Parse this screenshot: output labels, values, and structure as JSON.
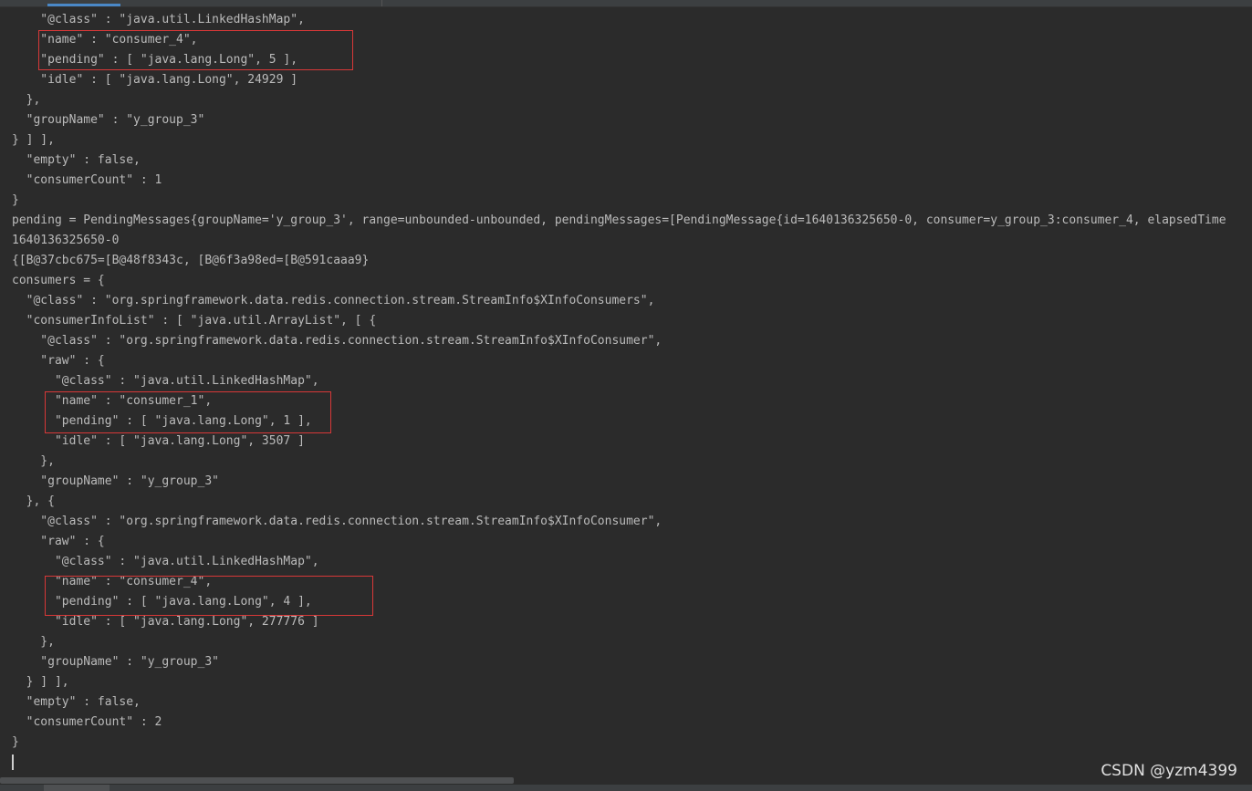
{
  "console": {
    "lines": [
      "    \"@class\" : \"java.util.LinkedHashMap\",",
      "    \"name\" : \"consumer_4\",",
      "    \"pending\" : [ \"java.lang.Long\", 5 ],",
      "    \"idle\" : [ \"java.lang.Long\", 24929 ]",
      "  },",
      "  \"groupName\" : \"y_group_3\"",
      "} ] ],",
      "  \"empty\" : false,",
      "  \"consumerCount\" : 1",
      "}",
      "pending = PendingMessages{groupName='y_group_3', range=unbounded-unbounded, pendingMessages=[PendingMessage{id=1640136325650-0, consumer=y_group_3:consumer_4, elapsedTime",
      "1640136325650-0",
      "{[B@37cbc675=[B@48f8343c, [B@6f3a98ed=[B@591caaa9}",
      "consumers = {",
      "  \"@class\" : \"org.springframework.data.redis.connection.stream.StreamInfo$XInfoConsumers\",",
      "  \"consumerInfoList\" : [ \"java.util.ArrayList\", [ {",
      "    \"@class\" : \"org.springframework.data.redis.connection.stream.StreamInfo$XInfoConsumer\",",
      "    \"raw\" : {",
      "      \"@class\" : \"java.util.LinkedHashMap\",",
      "      \"name\" : \"consumer_1\",",
      "      \"pending\" : [ \"java.lang.Long\", 1 ],",
      "      \"idle\" : [ \"java.lang.Long\", 3507 ]",
      "    },",
      "    \"groupName\" : \"y_group_3\"",
      "  }, {",
      "    \"@class\" : \"org.springframework.data.redis.connection.stream.StreamInfo$XInfoConsumer\",",
      "    \"raw\" : {",
      "      \"@class\" : \"java.util.LinkedHashMap\",",
      "      \"name\" : \"consumer_4\",",
      "      \"pending\" : [ \"java.lang.Long\", 4 ],",
      "      \"idle\" : [ \"java.lang.Long\", 277776 ]",
      "    },",
      "    \"groupName\" : \"y_group_3\"",
      "  } ] ],",
      "  \"empty\" : false,",
      "  \"consumerCount\" : 2",
      "}"
    ]
  },
  "watermark": "CSDN @yzm4399",
  "colors": {
    "background": "#2b2b2b",
    "text": "#bbbbbb",
    "highlight_border": "#d83838"
  }
}
